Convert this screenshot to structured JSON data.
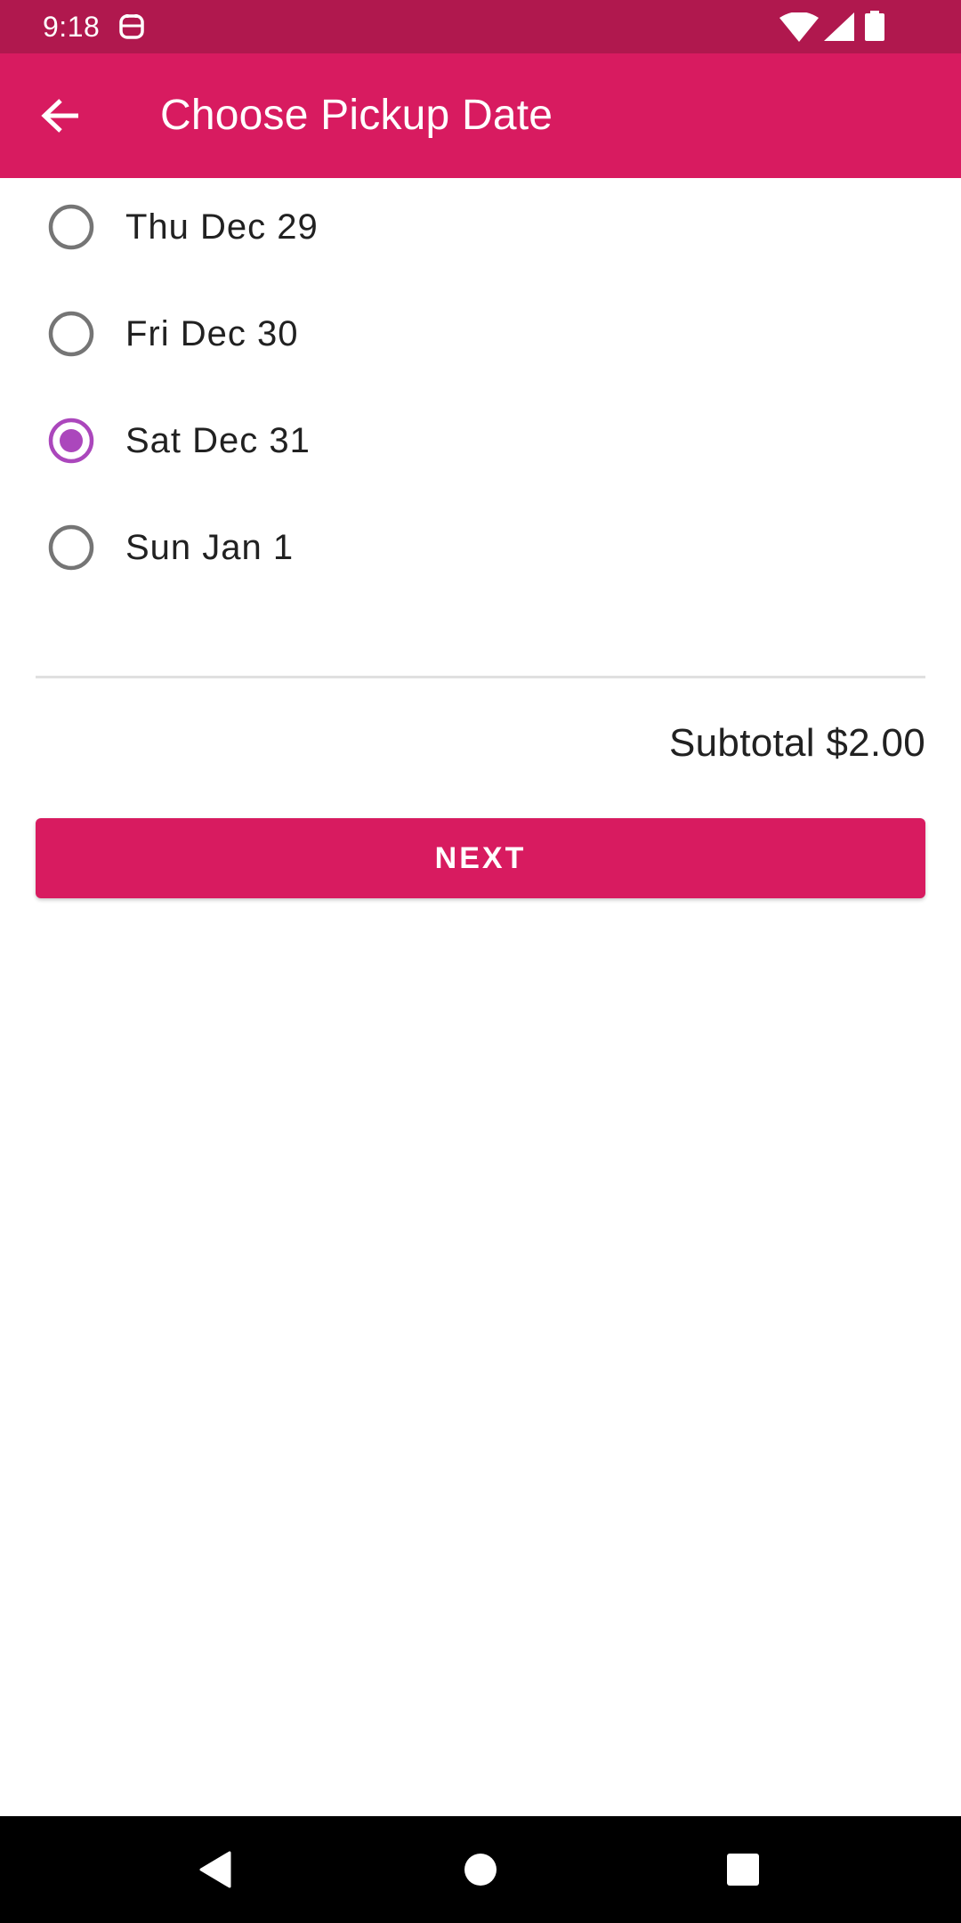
{
  "status_bar": {
    "time": "9:18",
    "background": "#B0184E",
    "app_icon": "notification-app-icon",
    "icons": [
      "wifi-icon",
      "signal-icon",
      "battery-icon"
    ]
  },
  "app_bar": {
    "title": "Choose Pickup Date",
    "background": "#D81B60",
    "back_icon": "arrow-back-icon"
  },
  "pickup_dates": {
    "options": [
      {
        "label": "Thu Dec 29",
        "selected": false
      },
      {
        "label": "Fri Dec 30",
        "selected": false
      },
      {
        "label": "Sat Dec 31",
        "selected": true
      },
      {
        "label": "Sun Jan 1",
        "selected": false
      }
    ],
    "selected_color": "#AB47BC",
    "unselected_color": "#757575"
  },
  "summary": {
    "subtotal": "Subtotal $2.00"
  },
  "actions": {
    "next_label": "NEXT",
    "next_color": "#D81B60"
  },
  "nav_bar": {
    "buttons": [
      "back-triangle-icon",
      "home-circle-icon",
      "recents-square-icon"
    ]
  }
}
